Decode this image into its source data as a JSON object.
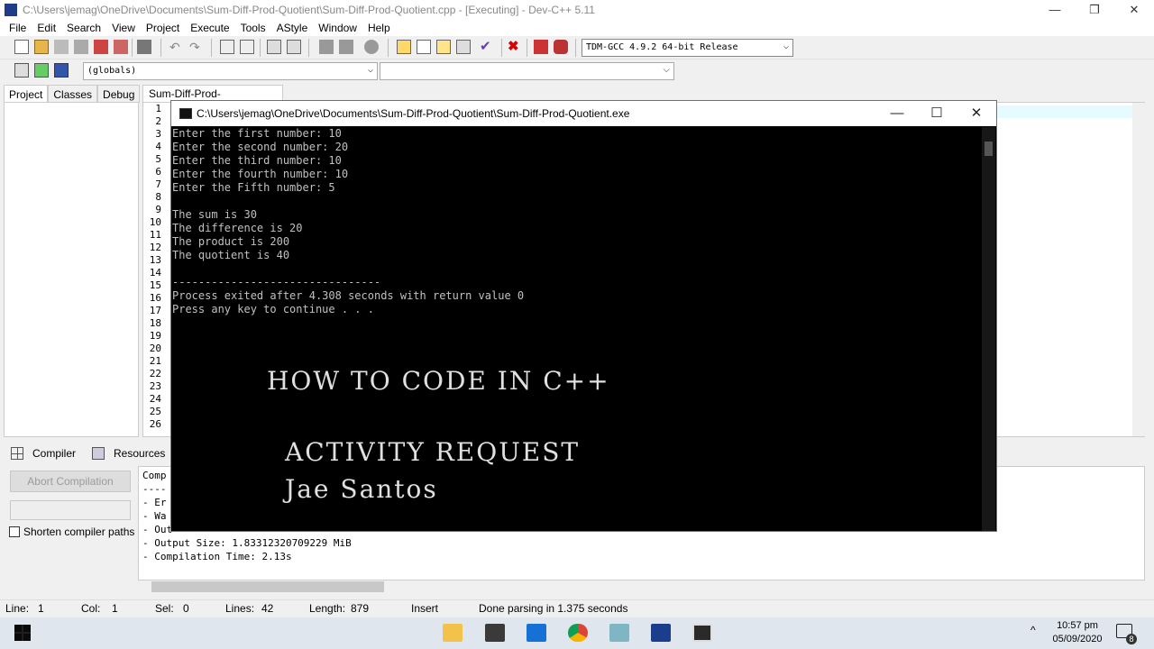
{
  "window": {
    "title": "C:\\Users\\jemag\\OneDrive\\Documents\\Sum-Diff-Prod-Quotient\\Sum-Diff-Prod-Quotient.cpp - [Executing] - Dev-C++ 5.11",
    "minimize": "—",
    "restore": "❐",
    "close": "✕"
  },
  "menu": [
    "File",
    "Edit",
    "Search",
    "View",
    "Project",
    "Execute",
    "Tools",
    "AStyle",
    "Window",
    "Help"
  ],
  "toolbar": {
    "compiler_select": "TDM-GCC 4.9.2 64-bit Release",
    "scope_select": "(globals)"
  },
  "left_tabs": [
    "Project",
    "Classes",
    "Debug"
  ],
  "editor": {
    "tab_label": "Sum-Diff-Prod-Quotient.cpp",
    "line_numbers": [
      "1",
      "2",
      "3",
      "4",
      "5",
      "6",
      "7",
      "8",
      "9",
      "10",
      "11",
      "12",
      "13",
      "14",
      "15",
      "16",
      "17",
      "18",
      "19",
      "20",
      "21",
      "22",
      "23",
      "24",
      "25",
      "26"
    ]
  },
  "bottom_tabs": [
    "Compiler",
    "Resources"
  ],
  "compiler_panel": {
    "abort_label": "Abort Compilation",
    "shorten_label": "Shorten compiler paths",
    "log_lines": [
      "Comp",
      "----",
      "- Er",
      "- Wa",
      "- Out",
      "- Output Size: 1.83312320709229 MiB",
      "- Compilation Time: 2.13s"
    ]
  },
  "statusbar": {
    "line_label": "Line:",
    "line_value": "1",
    "col_label": "Col:",
    "col_value": "1",
    "sel_label": "Sel:",
    "sel_value": "0",
    "lines_label": "Lines:",
    "lines_value": "42",
    "length_label": "Length:",
    "length_value": "879",
    "mode": "Insert",
    "message": "Done parsing in 1.375 seconds"
  },
  "console": {
    "title": "C:\\Users\\jemag\\OneDrive\\Documents\\Sum-Diff-Prod-Quotient\\Sum-Diff-Prod-Quotient.exe",
    "minimize": "—",
    "maximize": "☐",
    "close": "✕",
    "lines": [
      "Enter the first number: 10",
      "Enter the second number: 20",
      "Enter the third number: 10",
      "Enter the fourth number: 10",
      "Enter the Fifth number: 5",
      "",
      "The sum is 30",
      "The difference is 20",
      "The product is 200",
      "The quotient is 40",
      "",
      "--------------------------------",
      "Process exited after 4.308 seconds with return value 0",
      "Press any key to continue . . ."
    ]
  },
  "overlay": {
    "line1": "HOW TO CODE IN C++",
    "line2": "ACTIVITY REQUEST",
    "line3": "Jae Santos"
  },
  "taskbar": {
    "time": "10:57 pm",
    "date": "05/09/2020",
    "notification_count": "8",
    "tray_chevron": "^"
  },
  "colors": {
    "console_bg": "#000000",
    "console_text": "#c0c0c0",
    "taskbar_bg": "#dfe6ee",
    "line_highlight": "#e6fbff"
  }
}
